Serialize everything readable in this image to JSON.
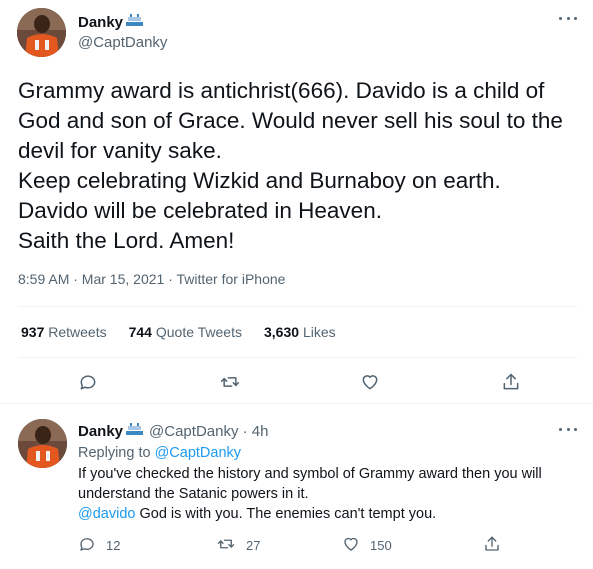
{
  "main_tweet": {
    "name": "Danky",
    "handle": "@CaptDanky",
    "text_lines": [
      "Grammy award is antichrist(666). Davido is a child of",
      "God and son of Grace. Would never sell his soul to the",
      "devil for vanity sake.",
      "Keep celebrating Wizkid and Burnaboy on earth.",
      "Davido will be celebrated in Heaven.",
      "Saith the Lord. Amen!"
    ],
    "meta": "8:59 AM · Mar 15, 2021 · Twitter for iPhone",
    "stats": {
      "retweets_count": "937",
      "retweets_label": "Retweets",
      "quotes_count": "744",
      "quotes_label": "Quote Tweets",
      "likes_count": "3,630",
      "likes_label": "Likes"
    },
    "icons": [
      "reply-icon",
      "retweet-icon",
      "like-icon",
      "share-icon",
      "more-icon",
      "flag-icon"
    ]
  },
  "reply_tweet": {
    "name": "Danky",
    "handle_time": "@CaptDanky · 4h",
    "replying_prefix": "Replying to",
    "replying_to": "@CaptDanky",
    "line1": "If you've checked the history and symbol of Grammy award then you will",
    "line2": "understand the Satanic powers in it.",
    "mention": "@davido",
    "line3_rest": " God is with you. The enemies can't tempt you.",
    "reply_count": "12",
    "retweet_count": "27",
    "like_count": "150"
  },
  "colors": {
    "text": "#0f1419",
    "secondary": "#536471",
    "link": "#1d9bf0",
    "border": "#eff3f4"
  }
}
